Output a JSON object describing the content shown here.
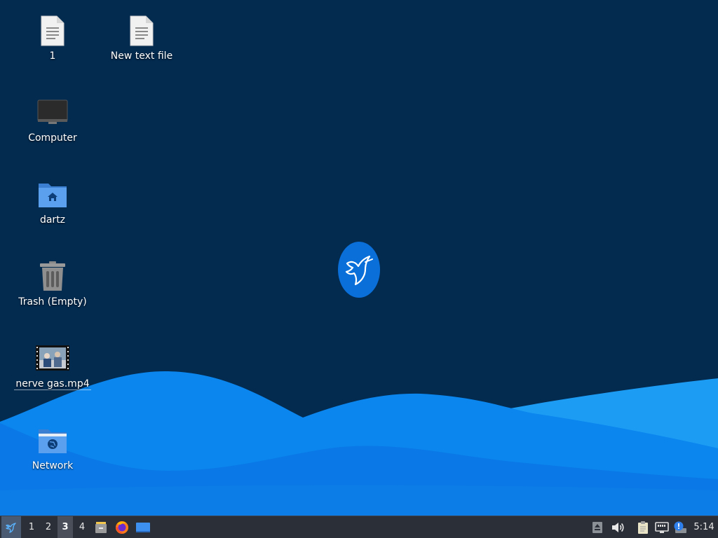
{
  "desktop": {
    "icons": [
      {
        "name": "file-1",
        "label": "1",
        "icon": "text-file-icon"
      },
      {
        "name": "new-text-file",
        "label": "New text file",
        "icon": "text-file-icon"
      },
      {
        "name": "computer",
        "label": "Computer",
        "icon": "monitor-icon"
      },
      {
        "name": "dartz",
        "label": "dartz",
        "icon": "home-folder-icon"
      },
      {
        "name": "trash",
        "label": "Trash (Empty)",
        "icon": "trash-icon"
      },
      {
        "name": "nerve-gas-video",
        "label": "nerve gas.mp4",
        "icon": "video-thumbnail-icon"
      },
      {
        "name": "network",
        "label": "Network",
        "icon": "network-folder-icon"
      }
    ],
    "wallpaper": {
      "logo": "hummingbird-logo",
      "background": "#032a4f",
      "wave_colors": [
        "#0066d9",
        "#0a86ee",
        "#1b9cf6"
      ]
    }
  },
  "taskbar": {
    "menu_icon": "hummingbird-menu-icon",
    "workspaces": [
      "1",
      "2",
      "3",
      "4"
    ],
    "active_workspace": "3",
    "launchers": [
      "file-manager-icon",
      "firefox-icon",
      "show-desktop-icon"
    ],
    "tray": [
      "eject-icon",
      "volume-icon",
      "clipboard-icon",
      "network-wired-icon",
      "update-notifier-icon"
    ],
    "clock": "5:14"
  }
}
